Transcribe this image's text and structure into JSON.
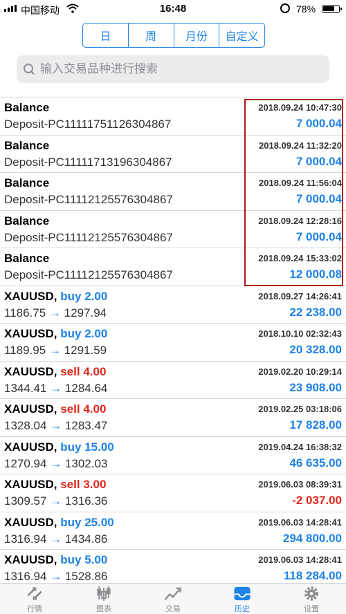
{
  "status_bar": {
    "carrier": "中国移动",
    "time": "16:48",
    "battery": "78%",
    "battery_fraction": 0.78
  },
  "period_tabs": [
    {
      "label": "日",
      "active": false
    },
    {
      "label": "周",
      "active": false
    },
    {
      "label": "月份",
      "active": false
    },
    {
      "label": "自定义",
      "active": true
    }
  ],
  "search": {
    "placeholder": "输入交易品种进行搜索",
    "value": ""
  },
  "records": [
    {
      "symbol": "Balance",
      "side": "",
      "lots": "",
      "detail": "Deposit-PC11111751126304867",
      "time": "2018.09.24 10:47:30",
      "amount": "7 000.04",
      "negative": false
    },
    {
      "symbol": "Balance",
      "side": "",
      "lots": "",
      "detail": "Deposit-PC11111713196304867",
      "time": "2018.09.24 11:32:20",
      "amount": "7 000.04",
      "negative": false
    },
    {
      "symbol": "Balance",
      "side": "",
      "lots": "",
      "detail": "Deposit-PC11112125576304867",
      "time": "2018.09.24 11:56:04",
      "amount": "7 000.04",
      "negative": false
    },
    {
      "symbol": "Balance",
      "side": "",
      "lots": "",
      "detail": "Deposit-PC11112125576304867",
      "time": "2018.09.24 12:28:16",
      "amount": "7 000.04",
      "negative": false
    },
    {
      "symbol": "Balance",
      "side": "",
      "lots": "",
      "detail": "Deposit-PC11112125576304867",
      "time": "2018.09.24 15:33:02",
      "amount": "12 000.08",
      "negative": false
    },
    {
      "symbol": "XAUUSD,",
      "side": "buy",
      "lots": "2.00",
      "open_price": "1186.75",
      "close_price": "1297.94",
      "time": "2018.09.27 14:26:41",
      "amount": "22 238.00",
      "negative": false
    },
    {
      "symbol": "XAUUSD,",
      "side": "buy",
      "lots": "2.00",
      "open_price": "1189.95",
      "close_price": "1291.59",
      "time": "2018.10.10 02:32:43",
      "amount": "20 328.00",
      "negative": false
    },
    {
      "symbol": "XAUUSD,",
      "side": "sell",
      "lots": "4.00",
      "open_price": "1344.41",
      "close_price": "1284.64",
      "time": "2019.02.20 10:29:14",
      "amount": "23 908.00",
      "negative": false
    },
    {
      "symbol": "XAUUSD,",
      "side": "sell",
      "lots": "4.00",
      "open_price": "1328.04",
      "close_price": "1283.47",
      "time": "2019.02.25 03:18:06",
      "amount": "17 828.00",
      "negative": false
    },
    {
      "symbol": "XAUUSD,",
      "side": "buy",
      "lots": "15.00",
      "open_price": "1270.94",
      "close_price": "1302.03",
      "time": "2019.04.24 16:38:32",
      "amount": "46 635.00",
      "negative": false
    },
    {
      "symbol": "XAUUSD,",
      "side": "sell",
      "lots": "3.00",
      "open_price": "1309.57",
      "close_price": "1316.36",
      "time": "2019.06.03 08:39:31",
      "amount": "-2 037.00",
      "negative": true
    },
    {
      "symbol": "XAUUSD,",
      "side": "buy",
      "lots": "25.00",
      "open_price": "1316.94",
      "close_price": "1434.86",
      "time": "2019.06.03 14:28:41",
      "amount": "294 800.00",
      "negative": false
    },
    {
      "symbol": "XAUUSD,",
      "side": "buy",
      "lots": "5.00",
      "open_price": "1316.94",
      "close_price": "1528.86",
      "time": "2019.06.03 14:28:41",
      "amount": "118 284.00",
      "negative": false
    }
  ],
  "arrow_glyph": "→",
  "tabbar": [
    {
      "label": "行情",
      "icon": "quotes-icon",
      "active": false
    },
    {
      "label": "图表",
      "icon": "chart-icon",
      "active": false
    },
    {
      "label": "交易",
      "icon": "trade-icon",
      "active": false
    },
    {
      "label": "历史",
      "icon": "history-icon",
      "active": true
    },
    {
      "label": "设置",
      "icon": "settings-icon",
      "active": false
    }
  ],
  "colors": {
    "accent": "#1e82e6",
    "sell": "#e0261c",
    "highlight_box": "#b0171c"
  }
}
